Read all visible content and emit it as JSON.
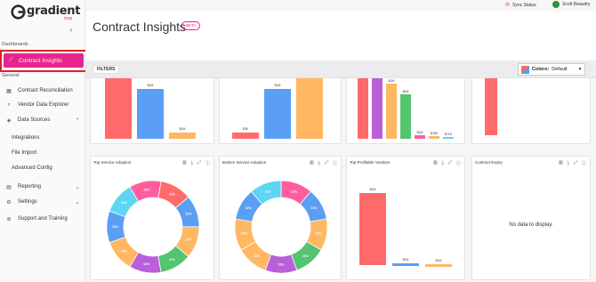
{
  "brand": {
    "name": "gradient",
    "sub": "msp"
  },
  "topbar": {
    "sync_label": "Sync Status",
    "user_name": "Scott Beaudry"
  },
  "sidebar": {
    "section_dashboards": "Dashboards",
    "section_general": "General",
    "active_label": "Contract Insights",
    "items": [
      {
        "label": "Contract Reconciliation",
        "icon": "table-icon"
      },
      {
        "label": "Vendor Data Explorer",
        "icon": "search-icon"
      },
      {
        "label": "Data Sources",
        "icon": "cube-icon"
      },
      {
        "label": "Reporting",
        "icon": "document-icon"
      },
      {
        "label": "Settings",
        "icon": "gear-icon"
      },
      {
        "label": "Support and Training",
        "icon": "help-icon"
      }
    ],
    "sub_items": [
      "Integrations",
      "File Import",
      "Advanced Config"
    ]
  },
  "header": {
    "title": "Contract Insights",
    "badge": "BETA"
  },
  "filterbar": {
    "filters_label": "FILTERS",
    "colors_label": "Colors:",
    "colors_value": "Default"
  },
  "palette": {
    "red": "#ff6b6b",
    "blue": "#5b9ef5",
    "orange": "#ffb762",
    "purple": "#b85fd9",
    "green": "#54c46e",
    "pink": "#ff5e9c",
    "cyan": "#5cd6f2",
    "accent": "#e8258c"
  },
  "cards": {
    "top_row": [
      {
        "labels": [
          "$1M",
          "$1M"
        ]
      },
      {
        "labels": [
          "$3K",
          "$1M"
        ]
      },
      {
        "labels": [
          "$1M",
          "$1M",
          "$1M",
          "$78K",
          "$71K",
          "$14K"
        ]
      },
      {
        "labels": []
      }
    ],
    "service_adoption": {
      "title": "Top Service Adoption",
      "labels": [
        "11%",
        "11%",
        "11%",
        "11%",
        "11%",
        "11%",
        "11%",
        "11%",
        "11%"
      ]
    },
    "bottom_adoption": {
      "title": "Bottom Service Adoption",
      "labels": [
        "11%",
        "11%",
        "11%",
        "11%",
        "11%",
        "11%",
        "11%",
        "11%",
        "11%"
      ]
    },
    "vendors": {
      "title": "Top Profitable Vendors",
      "labels": [
        "$1M",
        "$1M",
        "$1M"
      ]
    },
    "expiry": {
      "title": "Contract Expiry",
      "empty_text": "No data to display."
    }
  }
}
